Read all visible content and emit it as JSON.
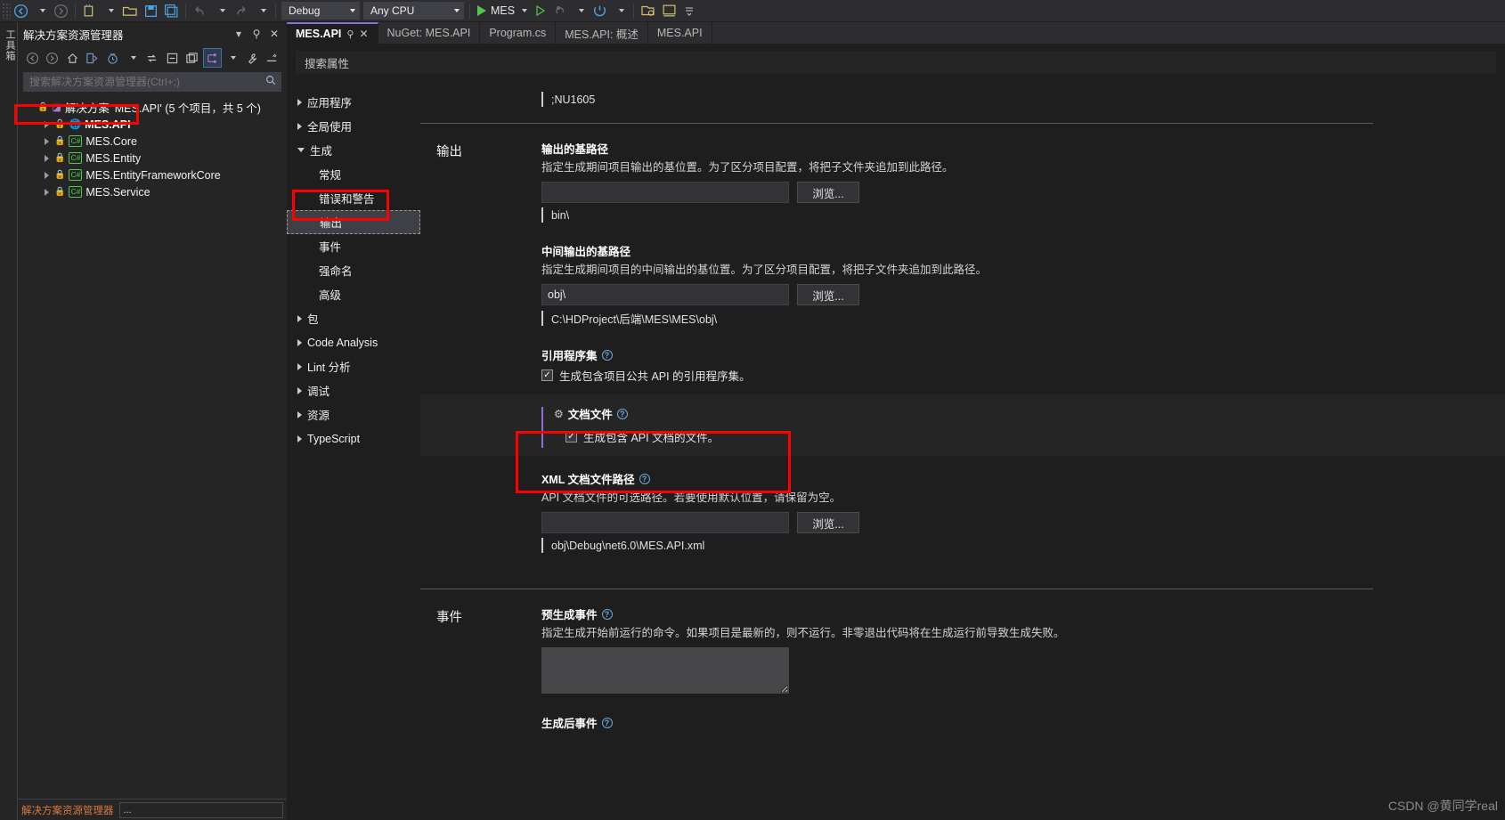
{
  "toolbar": {
    "back_icon": "back-arrow-icon",
    "forward_icon": "forward-arrow-icon",
    "new_item_icon": "new-item-icon",
    "open_icon": "open-folder-icon",
    "save_icon": "save-icon",
    "save_all_icon": "save-all-icon",
    "undo_icon": "undo-icon",
    "redo_icon": "redo-icon",
    "config_value": "Debug",
    "platform_value": "Any CPU",
    "run_label": "MES",
    "run_icon": "play-icon",
    "run_no_debug_icon": "play-outline-icon",
    "hot_reload_icon": "hot-reload-icon",
    "restart_icon": "restart-icon",
    "tools_icon": "tools-icon",
    "window_icon": "window-icon"
  },
  "vdock": {
    "toolbox_label": "工具箱"
  },
  "solution_explorer": {
    "title": "解决方案资源管理器",
    "dropdown_icon": "chevron-down-icon",
    "pin_icon": "pin-icon",
    "close_icon": "close-icon",
    "toolbar_icons": [
      "back-arrow-icon",
      "forward-arrow-icon",
      "home-icon",
      "sync-with-editor-icon",
      "pending-changes-icon",
      "refresh-icon",
      "collapse-all-icon",
      "new-folder-icon",
      "show-all-files-icon",
      "properties-wrench-icon",
      "preview-icon"
    ],
    "search_placeholder": "搜索解决方案资源管理器(Ctrl+;)",
    "search_value": "",
    "search_icon": "search-icon",
    "solution_node": "解决方案 'MES.API' (5 个项目，共 5 个)",
    "projects": [
      {
        "name": "MES.API",
        "kind": "web",
        "selected": true
      },
      {
        "name": "MES.Core",
        "kind": "cs",
        "selected": false
      },
      {
        "name": "MES.Entity",
        "kind": "cs",
        "selected": false
      },
      {
        "name": "MES.EntityFrameworkCore",
        "kind": "cs",
        "selected": false
      },
      {
        "name": "MES.Service",
        "kind": "cs",
        "selected": false
      }
    ],
    "status_label": "解决方案资源管理器",
    "status_box": "..."
  },
  "tabs": [
    {
      "label": "MES.API",
      "active": true,
      "pin_icon": "pin-icon",
      "close_icon": "close-icon"
    },
    {
      "label": "NuGet: MES.API",
      "active": false
    },
    {
      "label": "Program.cs",
      "active": false
    },
    {
      "label": "MES.API: 概述",
      "active": false
    },
    {
      "label": "MES.API",
      "active": false
    }
  ],
  "property_page": {
    "search_placeholder": "搜索属性",
    "nav": [
      {
        "label": "应用程序",
        "level": 0,
        "expanded": false,
        "selected": false
      },
      {
        "label": "全局使用",
        "level": 0,
        "expanded": false,
        "selected": false
      },
      {
        "label": "生成",
        "level": 0,
        "expanded": true,
        "selected": false
      },
      {
        "label": "常规",
        "level": 1,
        "expanded": null,
        "selected": false
      },
      {
        "label": "错误和警告",
        "level": 1,
        "expanded": null,
        "selected": false
      },
      {
        "label": "输出",
        "level": 1,
        "expanded": null,
        "selected": true
      },
      {
        "label": "事件",
        "level": 1,
        "expanded": null,
        "selected": false
      },
      {
        "label": "强命名",
        "level": 1,
        "expanded": null,
        "selected": false
      },
      {
        "label": "高级",
        "level": 1,
        "expanded": null,
        "selected": false
      },
      {
        "label": "包",
        "level": 0,
        "expanded": false,
        "selected": false
      },
      {
        "label": "Code Analysis",
        "level": 0,
        "expanded": false,
        "selected": false
      },
      {
        "label": "Lint 分析",
        "level": 0,
        "expanded": false,
        "selected": false
      },
      {
        "label": "调试",
        "level": 0,
        "expanded": false,
        "selected": false
      },
      {
        "label": "资源",
        "level": 0,
        "expanded": false,
        "selected": false
      },
      {
        "label": "TypeScript",
        "level": 0,
        "expanded": false,
        "selected": false
      }
    ],
    "top_hint": ";NU1605",
    "output_section": {
      "label": "输出",
      "base_output_path": {
        "title": "输出的基路径",
        "desc": "指定生成期间项目输出的基位置。为了区分项目配置，将把子文件夹追加到此路径。",
        "value": "",
        "browse_label": "浏览...",
        "hint": "bin\\"
      },
      "intermediate_output_path": {
        "title": "中间输出的基路径",
        "desc": "指定生成期间项目的中间输出的基位置。为了区分项目配置，将把子文件夹追加到此路径。",
        "value": "obj\\",
        "browse_label": "浏览...",
        "hint": "C:\\HDProject\\后端\\MES\\MES\\obj\\"
      },
      "reference_assembly": {
        "title": "引用程序集",
        "help_icon": "help-icon",
        "checkbox_label": "生成包含项目公共 API 的引用程序集。",
        "checked": true
      },
      "documentation_file": {
        "title": "文档文件",
        "gear_icon": "gear-icon",
        "help_icon": "help-icon",
        "checkbox_label": "生成包含 API 文档的文件。",
        "checked": true
      },
      "xml_doc_path": {
        "title": "XML 文档文件路径",
        "help_icon": "help-icon",
        "desc": "API 文档文件的可选路径。若要使用默认位置，请保留为空。",
        "value": "",
        "browse_label": "浏览...",
        "hint": "obj\\Debug\\net6.0\\MES.API.xml"
      }
    },
    "events_section": {
      "label": "事件",
      "pre_build": {
        "title": "预生成事件",
        "help_icon": "help-icon",
        "desc": "指定生成开始前运行的命令。如果项目是最新的，则不运行。非零退出代码将在生成运行前导致生成失败。",
        "value": ""
      },
      "post_build": {
        "title": "生成后事件",
        "help_icon": "help-icon"
      }
    }
  },
  "annotations": {
    "color": "#ff0000",
    "boxes": [
      {
        "name": "mes-api-project-highlight"
      },
      {
        "name": "output-nav-highlight"
      },
      {
        "name": "documentation-file-highlight"
      }
    ]
  },
  "watermark": "CSDN @黄同学real"
}
